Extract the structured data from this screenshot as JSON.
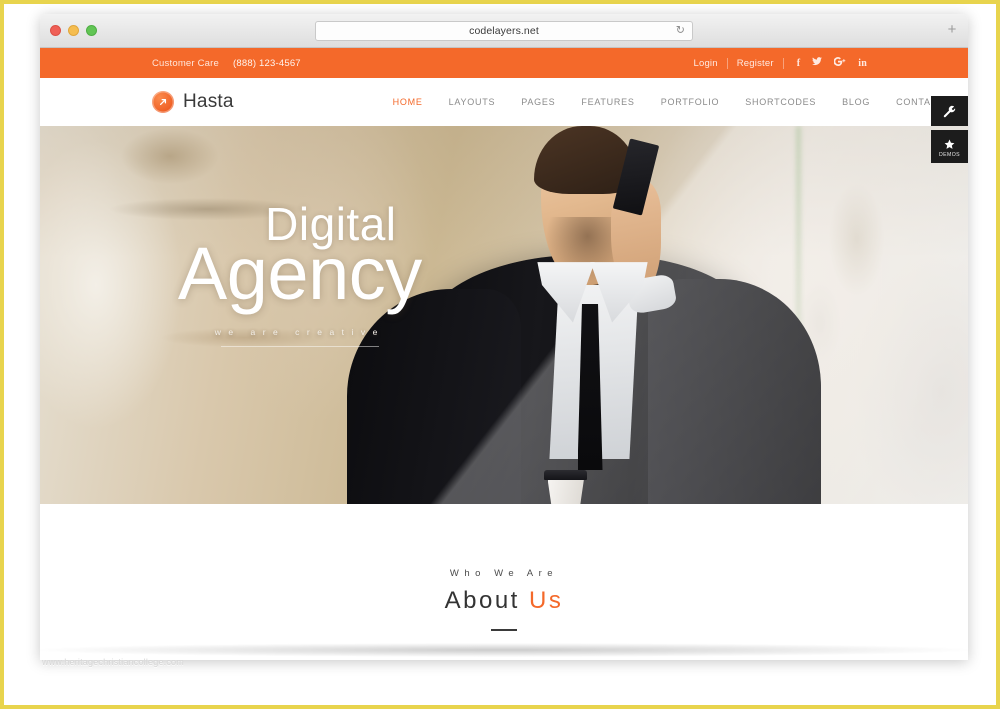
{
  "browser": {
    "url": "codelayers.net",
    "reload_icon": "reload-icon",
    "new_tab_label": "+",
    "traffic_lights": [
      "close",
      "minimize",
      "maximize"
    ]
  },
  "topbar": {
    "customer_care_label": "Customer Care",
    "phone": "(888) 123-4567",
    "login_label": "Login",
    "register_label": "Register",
    "social": [
      {
        "name": "facebook-icon",
        "glyph": "f"
      },
      {
        "name": "twitter-icon",
        "glyph": "ᵛ"
      },
      {
        "name": "google-plus-icon",
        "glyph": "g+"
      },
      {
        "name": "linkedin-icon",
        "glyph": "in"
      }
    ],
    "background_color": "#f4692a"
  },
  "navbar": {
    "brand_name": "Hasta",
    "brand_mark": "arrow-circle-icon",
    "items": [
      {
        "label": "HOME",
        "active": true
      },
      {
        "label": "LAYOUTS",
        "active": false
      },
      {
        "label": "PAGES",
        "active": false
      },
      {
        "label": "FEATURES",
        "active": false
      },
      {
        "label": "PORTFOLIO",
        "active": false
      },
      {
        "label": "SHORTCODES",
        "active": false
      },
      {
        "label": "BLOG",
        "active": false
      },
      {
        "label": "CONTACT",
        "active": false
      }
    ],
    "accent_color": "#f4692a",
    "inactive_color": "#8b8b8b"
  },
  "side_tools": {
    "settings_icon": "wrench-icon",
    "demos_icon": "star-icon",
    "demos_label": "DEMOS",
    "background_color": "#1c1c1c"
  },
  "hero": {
    "line1": "Digital",
    "line2": "Agency",
    "tagline": "We are creative",
    "image_description": "smiling businessman in black suit talking on mobile phone holding coffee cup"
  },
  "about": {
    "kicker": "Who We Are",
    "title_main": "About ",
    "title_accent": "Us",
    "accent_color": "#f4692a"
  },
  "watermark": {
    "text": "www.heritagechristiancollege.com"
  }
}
